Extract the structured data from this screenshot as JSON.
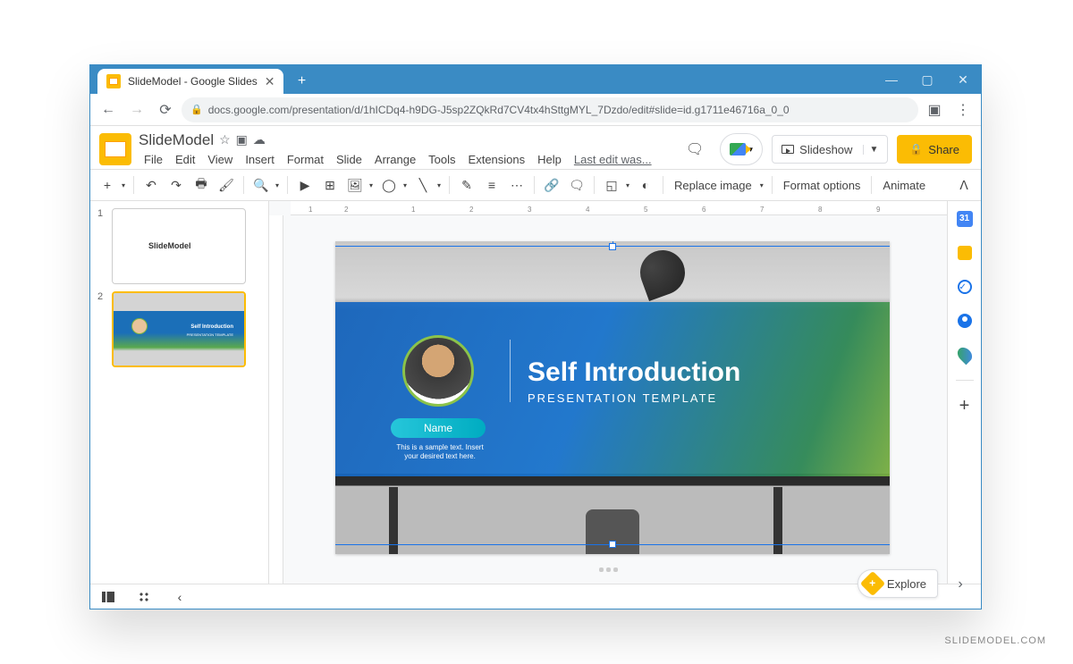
{
  "browser": {
    "tab_title": "SlideModel - Google Slides",
    "url_display": "docs.google.com/presentation/d/1hICDq4-h9DG-J5sp2ZQkRd7CV4tx4hSttgMYL_7Dzdo/edit#slide=id.g1711e46716a_0_0",
    "window_controls": {
      "minimize": "—",
      "maximize": "▢",
      "close": "✕"
    }
  },
  "app": {
    "doc_title": "SlideModel",
    "star_icon": "☆",
    "move_icon": "▣",
    "cloud_icon": "☁",
    "last_edit": "Last edit was...",
    "slideshow_label": "Slideshow",
    "share_label": "Share"
  },
  "menus": [
    "File",
    "Edit",
    "View",
    "Insert",
    "Format",
    "Slide",
    "Arrange",
    "Tools",
    "Extensions",
    "Help"
  ],
  "toolbar": {
    "replace_image": "Replace image",
    "format_options": "Format options",
    "animate": "Animate"
  },
  "slides": {
    "thumb1": {
      "num": "1",
      "title": "SlideModel"
    },
    "thumb2": {
      "num": "2",
      "title": "Self Introduction",
      "subtitle": "PRESENTATION TEMPLATE"
    }
  },
  "slide_content": {
    "heading": "Self Introduction",
    "subheading": "PRESENTATION TEMPLATE",
    "name_label": "Name",
    "sample_text": "This is a sample text. Insert your desired text here."
  },
  "ruler_h": [
    "1",
    "2",
    "1",
    "2",
    "3",
    "4",
    "5",
    "6",
    "7",
    "8",
    "9"
  ],
  "explore": "Explore",
  "side_panel": {
    "calendar": "31"
  },
  "attribution": "SLIDEMODEL.COM"
}
